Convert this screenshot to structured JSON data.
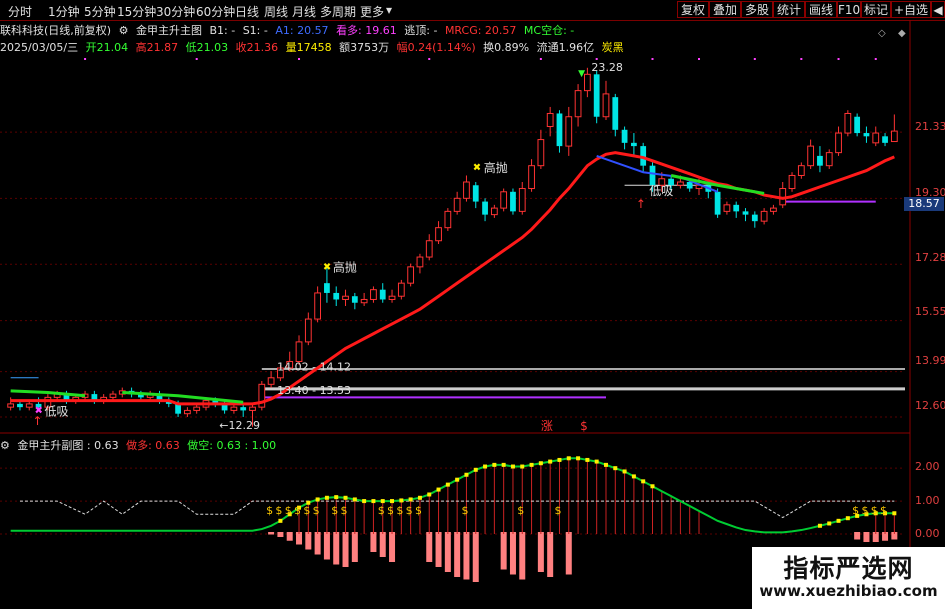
{
  "toolbar": {
    "timeframes": [
      "分时",
      "1分钟",
      "5分钟",
      "15分钟",
      "30分钟",
      "60分钟",
      "日线",
      "周线",
      "月线",
      "多周期",
      "更多"
    ],
    "right_buttons": [
      "复权",
      "叠加",
      "多股",
      "统计",
      "画线",
      "F10",
      "标记",
      "+自选",
      "◀"
    ]
  },
  "header": {
    "stock": "联科科技(日线,前复权)",
    "indicator_name": "金甲主升主图",
    "b1": "B1: -",
    "s1": "S1: -",
    "a1": "A1: 20.57",
    "kanduo": "看多: 19.61",
    "taoding": "逃顶: -",
    "mrcg": "MRCG: 20.57",
    "mc": "MC空仓: -"
  },
  "quote": {
    "date": "2025/03/05/三",
    "open": "开21.04",
    "high": "高21.87",
    "low": "低21.03",
    "close": "收21.36",
    "volume": "量17458",
    "amount": "额3753万",
    "change": "幅0.24(1.14%)",
    "turnover": "换0.89%",
    "float": "流通1.96亿",
    "tag": "炭黑"
  },
  "price_axis": [
    "21.33",
    "19.30",
    "17.28",
    "15.55",
    "13.99",
    "12.60"
  ],
  "current_price": "18.57",
  "sub_header": {
    "name": "金甲主升副图 : 0.63",
    "zuoduo": "做多: 0.63",
    "zuokong": "做空: 0.63 : 1.00"
  },
  "sub_axis": [
    "2.00",
    "1.00",
    "0.00"
  ],
  "annotations": {
    "gaopao": "高抛",
    "dixi": "低吸",
    "zhang": "涨",
    "dollar": "$",
    "range1": "14.02 - 14.12",
    "range2": "13.40 - 13.53",
    "low_mark": "12.29",
    "high_mark": "23.28"
  },
  "watermark": {
    "title": "指标严选网",
    "url": "www.xuezhibiao.com"
  },
  "colors": {
    "up": "#ff3333",
    "down": "#00e5e5",
    "ma": "#ff1a1a",
    "sub_line": "#00cc33",
    "sub_dot": "#ffee00",
    "sub_bar": "#ff8080"
  },
  "chart_data": {
    "type": "candlestick",
    "title": "",
    "ylim": [
      12.2,
      23.6
    ],
    "candles": [
      [
        12.9,
        13.0,
        13.2,
        12.8
      ],
      [
        13.0,
        12.9,
        13.1,
        12.8
      ],
      [
        12.9,
        13.0,
        13.1,
        12.8
      ],
      [
        13.0,
        12.9,
        13.2,
        12.8
      ],
      [
        12.9,
        13.2,
        13.3,
        12.8
      ],
      [
        13.2,
        13.3,
        13.4,
        13.1
      ],
      [
        13.3,
        13.1,
        13.4,
        13.0
      ],
      [
        13.1,
        13.2,
        13.3,
        13.0
      ],
      [
        13.2,
        13.3,
        13.4,
        13.1
      ],
      [
        13.3,
        13.1,
        13.4,
        13.0
      ],
      [
        13.1,
        13.2,
        13.3,
        13.0
      ],
      [
        13.2,
        13.3,
        13.4,
        13.1
      ],
      [
        13.3,
        13.4,
        13.5,
        13.2
      ],
      [
        13.4,
        13.3,
        13.5,
        13.2
      ],
      [
        13.3,
        13.2,
        13.4,
        13.1
      ],
      [
        13.2,
        13.3,
        13.4,
        13.1
      ],
      [
        13.3,
        13.1,
        13.4,
        13.0
      ],
      [
        13.1,
        13.0,
        13.2,
        12.9
      ],
      [
        13.0,
        12.7,
        13.1,
        12.6
      ],
      [
        12.7,
        12.8,
        12.9,
        12.6
      ],
      [
        12.8,
        12.9,
        13.0,
        12.7
      ],
      [
        12.9,
        13.1,
        13.2,
        12.8
      ],
      [
        13.1,
        13.0,
        13.2,
        12.9
      ],
      [
        13.0,
        12.8,
        13.1,
        12.7
      ],
      [
        12.8,
        12.9,
        13.0,
        12.7
      ],
      [
        12.9,
        12.8,
        13.0,
        12.6
      ],
      [
        12.8,
        12.9,
        13.0,
        12.3
      ],
      [
        12.9,
        13.6,
        13.7,
        12.8
      ],
      [
        13.6,
        13.8,
        14.0,
        13.5
      ],
      [
        13.8,
        14.1,
        14.2,
        13.7
      ],
      [
        14.1,
        14.3,
        14.6,
        14.0
      ],
      [
        14.3,
        14.9,
        15.1,
        14.2
      ],
      [
        14.9,
        15.6,
        15.8,
        14.8
      ],
      [
        15.6,
        16.4,
        16.6,
        15.5
      ],
      [
        16.7,
        16.4,
        17.2,
        16.1
      ],
      [
        16.4,
        16.2,
        16.6,
        16.0
      ],
      [
        16.2,
        16.3,
        16.5,
        16.0
      ],
      [
        16.3,
        16.1,
        16.4,
        15.9
      ],
      [
        16.1,
        16.2,
        16.4,
        16.0
      ],
      [
        16.2,
        16.5,
        16.6,
        16.1
      ],
      [
        16.5,
        16.2,
        16.7,
        16.1
      ],
      [
        16.2,
        16.3,
        16.5,
        16.1
      ],
      [
        16.3,
        16.7,
        16.8,
        16.2
      ],
      [
        16.7,
        17.2,
        17.3,
        16.6
      ],
      [
        17.2,
        17.5,
        17.6,
        17.0
      ],
      [
        17.5,
        18.0,
        18.2,
        17.4
      ],
      [
        18.0,
        18.4,
        18.6,
        17.9
      ],
      [
        18.4,
        18.9,
        19.0,
        18.3
      ],
      [
        18.9,
        19.3,
        19.5,
        18.8
      ],
      [
        19.3,
        19.8,
        20.0,
        19.2
      ],
      [
        19.7,
        19.2,
        19.8,
        19.0
      ],
      [
        19.2,
        18.8,
        19.3,
        18.6
      ],
      [
        18.8,
        19.0,
        19.1,
        18.7
      ],
      [
        19.0,
        19.5,
        19.6,
        18.9
      ],
      [
        19.5,
        18.9,
        19.6,
        18.8
      ],
      [
        18.9,
        19.6,
        19.8,
        18.8
      ],
      [
        19.6,
        20.3,
        20.5,
        19.5
      ],
      [
        20.3,
        21.1,
        21.4,
        20.2
      ],
      [
        21.5,
        21.9,
        22.1,
        21.2
      ],
      [
        21.9,
        20.9,
        22.0,
        20.7
      ],
      [
        20.9,
        21.8,
        22.1,
        20.6
      ],
      [
        21.8,
        22.6,
        22.8,
        21.5
      ],
      [
        22.6,
        23.1,
        23.3,
        22.4
      ],
      [
        23.1,
        21.8,
        23.2,
        21.6
      ],
      [
        21.8,
        22.5,
        22.9,
        21.7
      ],
      [
        22.4,
        21.4,
        22.5,
        21.2
      ],
      [
        21.4,
        21.0,
        21.5,
        20.8
      ],
      [
        21.0,
        20.9,
        21.3,
        20.6
      ],
      [
        20.9,
        20.3,
        21.0,
        20.1
      ],
      [
        20.3,
        19.7,
        20.4,
        19.5
      ],
      [
        19.7,
        19.9,
        20.1,
        19.5
      ],
      [
        19.9,
        19.7,
        20.0,
        19.5
      ],
      [
        19.7,
        19.8,
        20.0,
        19.6
      ],
      [
        19.8,
        19.6,
        19.9,
        19.5
      ],
      [
        19.6,
        19.7,
        19.9,
        19.4
      ],
      [
        19.7,
        19.5,
        19.8,
        19.3
      ],
      [
        19.5,
        18.8,
        19.6,
        18.7
      ],
      [
        18.9,
        19.1,
        19.2,
        18.8
      ],
      [
        19.1,
        18.9,
        19.2,
        18.7
      ],
      [
        18.9,
        18.8,
        19.0,
        18.6
      ],
      [
        18.8,
        18.6,
        18.9,
        18.4
      ],
      [
        18.6,
        18.9,
        19.0,
        18.5
      ],
      [
        18.9,
        19.0,
        19.1,
        18.8
      ],
      [
        19.1,
        19.6,
        19.8,
        19.0
      ],
      [
        19.6,
        20.0,
        20.1,
        19.5
      ],
      [
        20.0,
        20.3,
        20.4,
        19.9
      ],
      [
        20.3,
        20.9,
        21.1,
        20.2
      ],
      [
        20.6,
        20.3,
        20.9,
        20.1
      ],
      [
        20.3,
        20.7,
        20.8,
        20.2
      ],
      [
        20.7,
        21.3,
        21.5,
        20.6
      ],
      [
        21.3,
        21.9,
        22.0,
        21.2
      ],
      [
        21.8,
        21.3,
        21.9,
        21.2
      ],
      [
        21.3,
        21.2,
        21.5,
        21.0
      ],
      [
        21.0,
        21.3,
        21.5,
        20.9
      ],
      [
        21.2,
        21.0,
        21.3,
        20.9
      ],
      [
        21.04,
        21.36,
        21.87,
        21.03
      ]
    ],
    "ma": [
      13.1,
      13.1,
      13.1,
      13.1,
      13.1,
      13.1,
      13.1,
      13.1,
      13.1,
      13.1,
      13.1,
      13.1,
      13.1,
      13.1,
      13.1,
      13.1,
      13.1,
      13.1,
      13.0,
      13.0,
      13.0,
      13.0,
      13.0,
      13.0,
      13.0,
      13.0,
      13.0,
      13.05,
      13.15,
      13.3,
      13.5,
      13.7,
      13.9,
      14.1,
      14.3,
      14.5,
      14.7,
      14.85,
      15.0,
      15.15,
      15.3,
      15.45,
      15.6,
      15.75,
      15.9,
      16.1,
      16.3,
      16.5,
      16.7,
      16.9,
      17.1,
      17.3,
      17.5,
      17.7,
      17.9,
      18.1,
      18.35,
      18.65,
      18.95,
      19.3,
      19.6,
      19.95,
      20.3,
      20.5,
      20.65,
      20.7,
      20.65,
      20.6,
      20.55,
      20.45,
      20.35,
      20.25,
      20.15,
      20.05,
      19.95,
      19.85,
      19.75,
      19.7,
      19.6,
      19.55,
      19.5,
      19.4,
      19.35,
      19.3,
      19.35,
      19.45,
      19.55,
      19.65,
      19.75,
      19.85,
      19.95,
      20.05,
      20.15,
      20.3,
      20.45,
      20.57
    ],
    "osc": [
      0.1,
      0.1,
      0.1,
      0.1,
      0.1,
      0.1,
      0.1,
      0.1,
      0.1,
      0.1,
      0.1,
      0.1,
      0.1,
      0.1,
      0.1,
      0.1,
      0.1,
      0.1,
      0.1,
      0.1,
      0.1,
      0.1,
      0.1,
      0.1,
      0.1,
      0.1,
      0.1,
      0.15,
      0.25,
      0.4,
      0.6,
      0.8,
      0.95,
      1.05,
      1.1,
      1.12,
      1.1,
      1.05,
      1.0,
      1.0,
      1.0,
      1.0,
      1.02,
      1.05,
      1.1,
      1.2,
      1.35,
      1.5,
      1.65,
      1.8,
      1.95,
      2.05,
      2.1,
      2.1,
      2.05,
      2.05,
      2.1,
      2.15,
      2.2,
      2.25,
      2.3,
      2.3,
      2.25,
      2.2,
      2.1,
      2.0,
      1.9,
      1.75,
      1.6,
      1.45,
      1.3,
      1.15,
      1.0,
      0.85,
      0.7,
      0.55,
      0.4,
      0.3,
      0.2,
      0.12,
      0.08,
      0.05,
      0.05,
      0.05,
      0.08,
      0.12,
      0.18,
      0.25,
      0.32,
      0.4,
      0.48,
      0.55,
      0.6,
      0.63,
      0.63,
      0.63
    ],
    "sub_bars": [
      0,
      0,
      0,
      0,
      0,
      0,
      0,
      0,
      0,
      0,
      0,
      0,
      0,
      0,
      0,
      0,
      0,
      0,
      0,
      0,
      0,
      0,
      0,
      0,
      0,
      0,
      0,
      0,
      0.1,
      0.2,
      0.35,
      0.5,
      0.7,
      0.9,
      1.1,
      1.3,
      1.4,
      1.2,
      0,
      0.8,
      1.0,
      1.2,
      0,
      0,
      0,
      1.2,
      1.4,
      1.6,
      1.8,
      1.9,
      2.0,
      0,
      0,
      1.5,
      1.7,
      1.9,
      0,
      1.6,
      1.8,
      0,
      1.7,
      0,
      0,
      0,
      0,
      0,
      0,
      0,
      0,
      0,
      0,
      0,
      0,
      0,
      0,
      0,
      0,
      0,
      0,
      0,
      0,
      0,
      0,
      0,
      0,
      0,
      0,
      0,
      0,
      0,
      0,
      0.3,
      0.4,
      0.4,
      0.35,
      0.3
    ]
  }
}
